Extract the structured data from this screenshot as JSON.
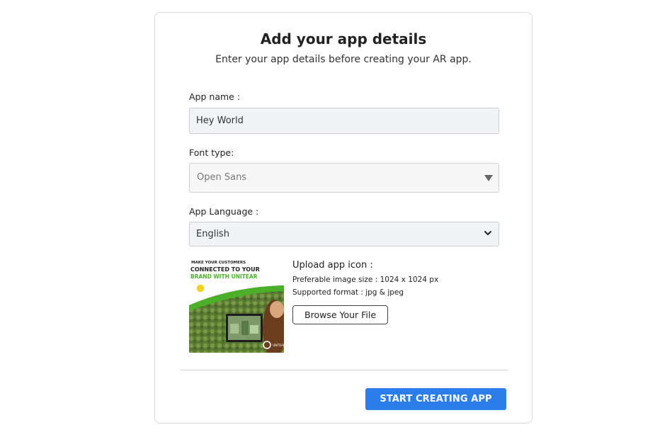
{
  "header": {
    "title": "Add your app details",
    "subtitle": "Enter your app details before creating your AR app."
  },
  "form": {
    "app_name_label": "App name :",
    "app_name_value": "Hey World",
    "font_type_label": "Font type:",
    "font_type_value": "Open Sans",
    "language_label": "App Language :",
    "language_value": "English"
  },
  "upload": {
    "title": "Upload app icon :",
    "size_label": "Preferable image size : ",
    "size_value": "1024 x 1024 px",
    "format_label": "Supported format : ",
    "format_value": "jpg & jpeg",
    "browse_label": "Browse Your File",
    "preview": {
      "line1": "MAKE YOUR CUSTOMERS",
      "line2": "CONNECTED TO YOUR",
      "line3": "BRAND WITH UNITEAR"
    }
  },
  "actions": {
    "start_label": "START CREATING APP"
  },
  "colors": {
    "primary_button": "#2b7de9",
    "accent_green": "#4caf2a",
    "card_border": "#dcdcdc"
  }
}
